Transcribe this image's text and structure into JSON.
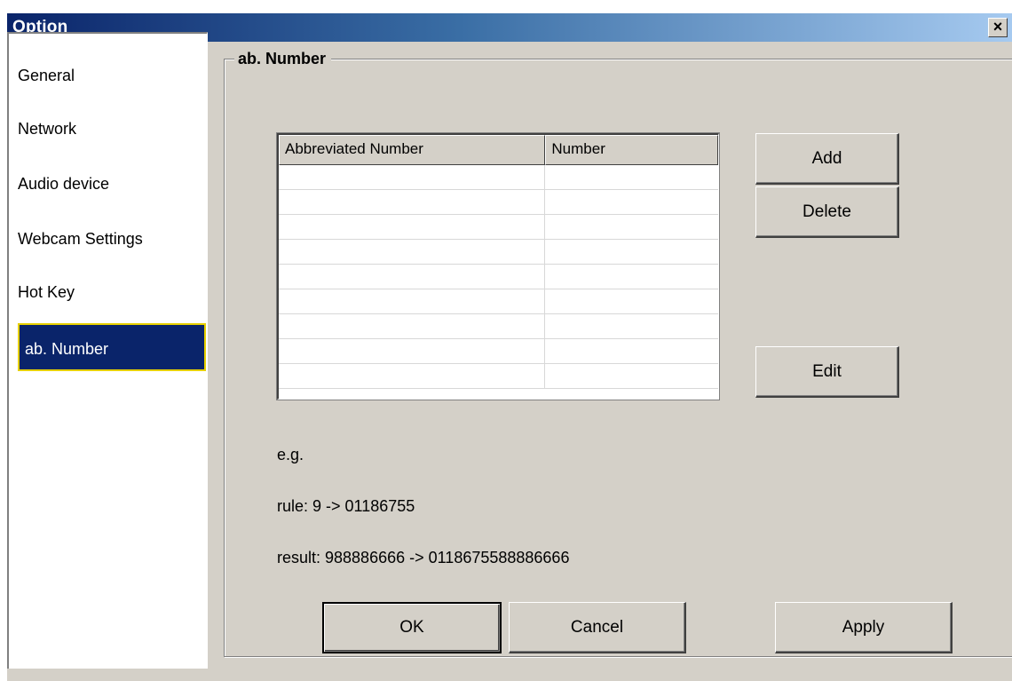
{
  "window": {
    "title": "Option",
    "close_label": "×"
  },
  "sidebar": {
    "items": [
      {
        "label": "General",
        "selected": false
      },
      {
        "label": "Network",
        "selected": false
      },
      {
        "label": "Audio device",
        "selected": false
      },
      {
        "label": "Webcam Settings",
        "selected": false
      },
      {
        "label": "Hot Key",
        "selected": false
      },
      {
        "label": "ab. Number",
        "selected": true
      }
    ]
  },
  "panel": {
    "title": "ab. Number",
    "table": {
      "columns": [
        "Abbreviated Number",
        "Number"
      ],
      "rows": [
        [
          "",
          ""
        ],
        [
          "",
          ""
        ],
        [
          "",
          ""
        ],
        [
          "",
          ""
        ],
        [
          "",
          ""
        ],
        [
          "",
          ""
        ],
        [
          "",
          ""
        ],
        [
          "",
          ""
        ],
        [
          "",
          ""
        ]
      ]
    },
    "buttons": {
      "add": "Add",
      "delete": "Delete",
      "edit": "Edit"
    },
    "example": {
      "heading": "e.g.",
      "rule": "rule: 9 -> 01186755",
      "result": "result: 988886666 -> 0118675588886666"
    }
  },
  "footer": {
    "ok": "OK",
    "cancel": "Cancel",
    "apply": "Apply"
  },
  "colors": {
    "selection_bg": "#0a246a",
    "selection_border": "#e6d000",
    "dialog_face": "#d4d0c8"
  }
}
